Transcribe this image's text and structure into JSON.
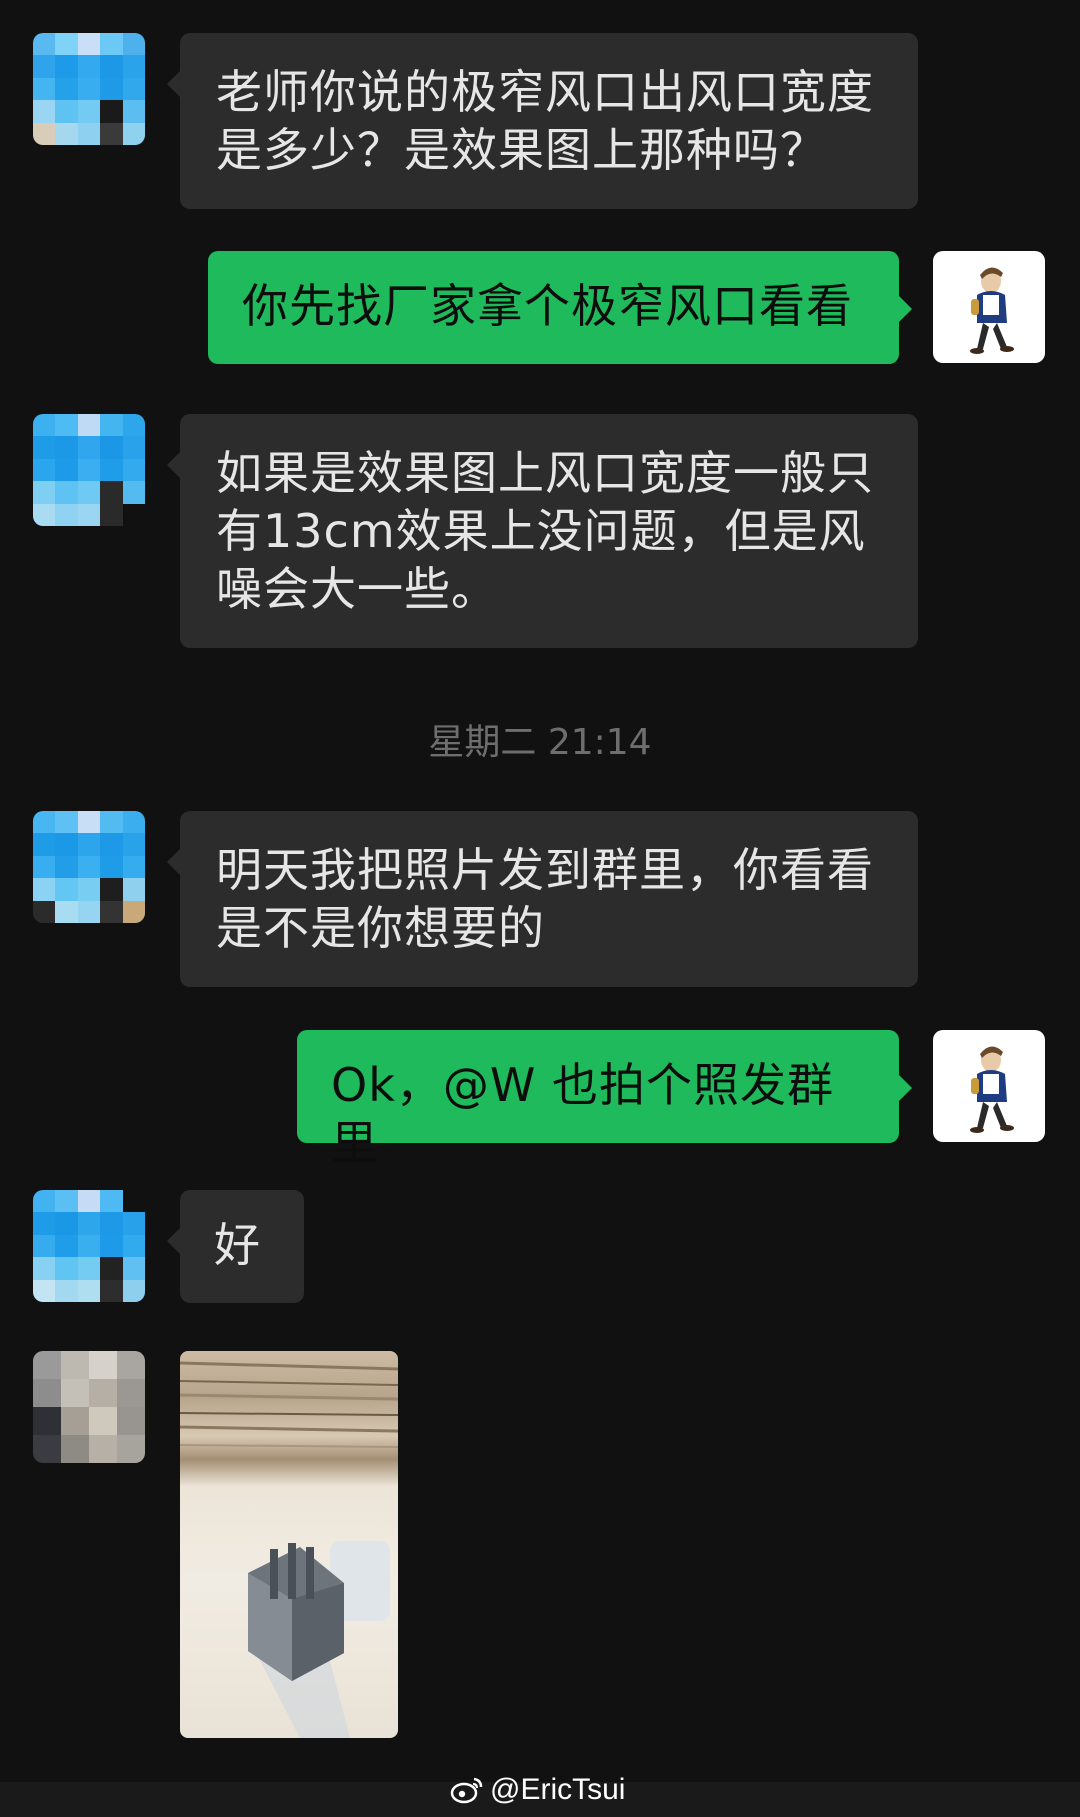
{
  "messages": {
    "m1": {
      "sender": "peer",
      "text_line1": "老师你说的极窄风口出风口宽度",
      "text_line2": "是多少？是效果图上那种吗？"
    },
    "m2": {
      "sender": "self",
      "text": "你先找厂家拿个极窄风口看看"
    },
    "m3": {
      "sender": "peer",
      "text_line1": "如果是效果图上风口宽度一般只",
      "text_line2": "有13cm效果上没问题，但是风",
      "text_line3": "噪会大一些。"
    },
    "timestamp": "星期二 21:14",
    "m4": {
      "sender": "peer",
      "text_line1": "明天我把照片发到群里，你看看",
      "text_line2": "是不是你想要的"
    },
    "m5": {
      "sender": "self",
      "text": "Ok，@W 也拍个照发群里"
    },
    "m6": {
      "sender": "peer",
      "text": "好"
    },
    "m7": {
      "sender": "peer2",
      "type": "image"
    }
  },
  "watermark": "@EricTsui",
  "colors": {
    "background": "#111111",
    "peer_bubble": "#2c2c2c",
    "self_bubble": "#1fba5b",
    "timestamp_text": "#6e6e6e"
  }
}
